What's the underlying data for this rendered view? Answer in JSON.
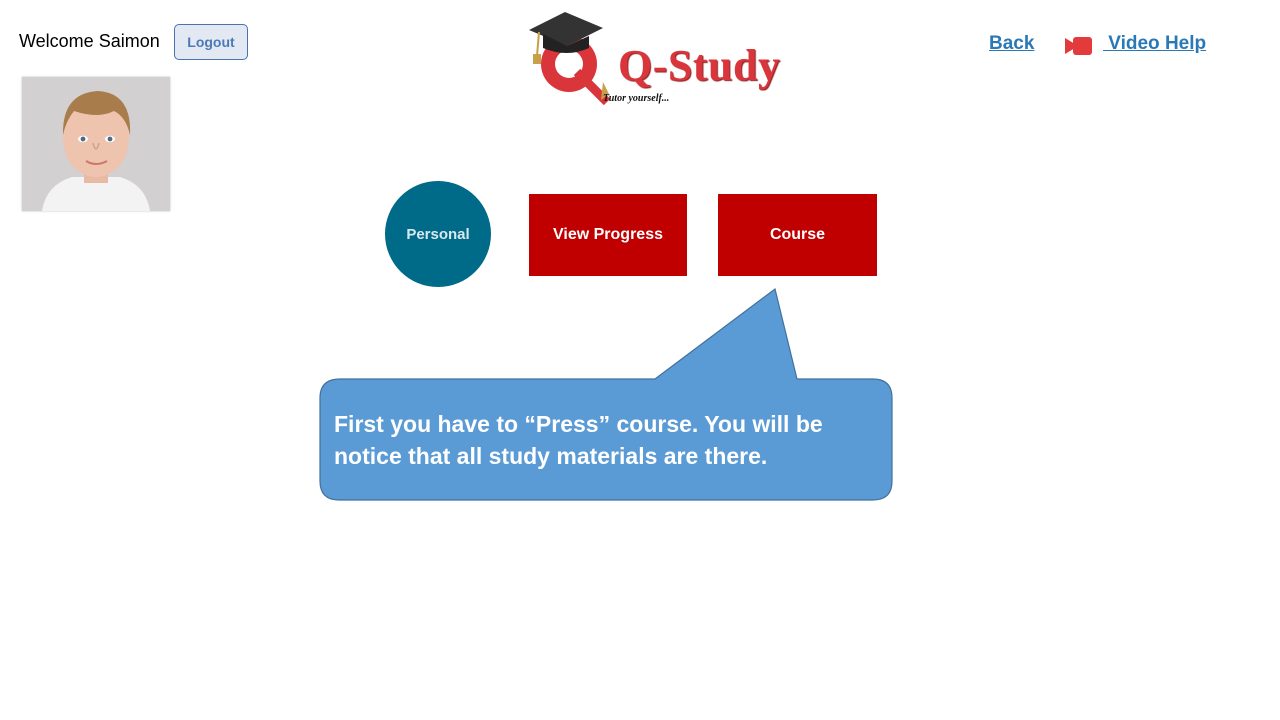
{
  "header": {
    "welcome_text": "Welcome Saimon",
    "logout_label": "Logout",
    "back_label": "Back",
    "video_help_label": " Video Help"
  },
  "logo": {
    "brand_text": "Q-Study",
    "tagline": "Tutor yourself..."
  },
  "nav": {
    "personal_label": "Personal",
    "view_progress_label": "View Progress",
    "course_label": "Course"
  },
  "callout": {
    "text": "First you have to “Press” course. You will be notice that all study materials are there."
  },
  "colors": {
    "personal_bg": "#006a89",
    "button_red": "#c00000",
    "callout_blue": "#5b9bd5",
    "link_blue": "#2a78b6",
    "brand_red": "#d9353b"
  },
  "icons": [
    "user-avatar-photo",
    "graduation-cap-icon",
    "video-camera-icon"
  ]
}
